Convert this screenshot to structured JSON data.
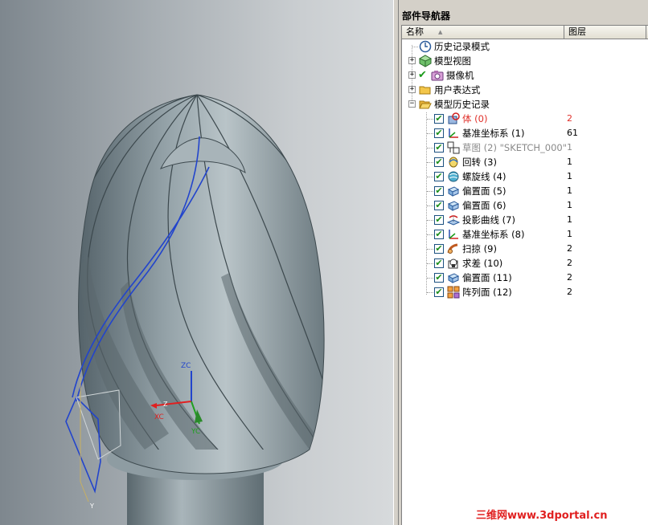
{
  "panel": {
    "title": "部件导航器"
  },
  "columns": {
    "name": "名称",
    "sort_indicator": "▲",
    "layer": "图层"
  },
  "tree": {
    "history_mode": "历史记录模式",
    "model_views": "模型视图",
    "cameras": "摄像机",
    "user_expressions": "用户表达式",
    "model_history": "模型历史记录",
    "expander_plus": "+",
    "expander_minus": "−",
    "check": "✔",
    "features": [
      {
        "label": "体 (0)",
        "layer": "2",
        "icon": "body-icon",
        "style": "red"
      },
      {
        "label": "基准坐标系 (1)",
        "layer": "61",
        "icon": "datum-csys-icon",
        "style": "normal"
      },
      {
        "label": "草图 (2) \"SKETCH_000\"",
        "layer": "1",
        "icon": "sketch-icon",
        "style": "dim"
      },
      {
        "label": "回转 (3)",
        "layer": "1",
        "icon": "revolve-icon",
        "style": "normal"
      },
      {
        "label": "螺旋线 (4)",
        "layer": "1",
        "icon": "helix-icon",
        "style": "normal"
      },
      {
        "label": "偏置面 (5)",
        "layer": "1",
        "icon": "offset-face-icon",
        "style": "normal"
      },
      {
        "label": "偏置面 (6)",
        "layer": "1",
        "icon": "offset-face-icon",
        "style": "normal"
      },
      {
        "label": "投影曲线 (7)",
        "layer": "1",
        "icon": "projected-curve-icon",
        "style": "normal"
      },
      {
        "label": "基准坐标系 (8)",
        "layer": "1",
        "icon": "datum-csys-icon",
        "style": "normal"
      },
      {
        "label": "扫掠 (9)",
        "layer": "2",
        "icon": "sweep-icon",
        "style": "normal"
      },
      {
        "label": "求差 (10)",
        "layer": "2",
        "icon": "subtract-icon",
        "style": "normal"
      },
      {
        "label": "偏置面 (11)",
        "layer": "2",
        "icon": "offset-face-icon",
        "style": "normal"
      },
      {
        "label": "阵列面 (12)",
        "layer": "2",
        "icon": "pattern-face-icon",
        "style": "normal"
      }
    ]
  },
  "viewport": {
    "axis_labels": {
      "zc": "ZC",
      "xc": "XC",
      "yc": "YC",
      "z": "Z",
      "y": "Y"
    }
  },
  "watermark": "三维网www.3dportal.cn",
  "colors": {
    "model": "#8a989e",
    "model_light": "#b4c0c4",
    "model_dark": "#4f5c61",
    "curve_blue": "#2244cc",
    "axis_red": "#e02020",
    "axis_green": "#20a020"
  }
}
